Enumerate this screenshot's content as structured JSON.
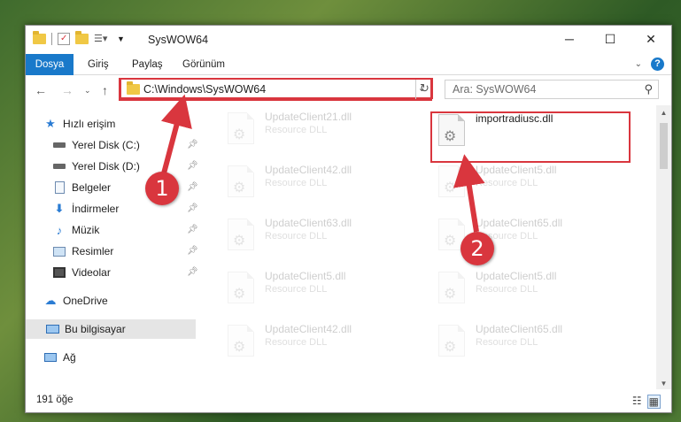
{
  "window": {
    "title": "SysWOW64",
    "controls": [
      "─",
      "☐",
      "✕"
    ]
  },
  "ribbon": {
    "tabs": [
      "Dosya",
      "Giriş",
      "Paylaş",
      "Görünüm"
    ],
    "help": "?"
  },
  "address": {
    "path": "C:\\Windows\\SysWOW64",
    "search_placeholder": "Ara: SysWOW64"
  },
  "nav": {
    "quick_access": "Hızlı erişim",
    "items": [
      {
        "label": "Yerel Disk (C:)",
        "icon": "drive-icon",
        "pinned": true
      },
      {
        "label": "Yerel Disk (D:)",
        "icon": "drive-icon",
        "pinned": true
      },
      {
        "label": "Belgeler",
        "icon": "documents-icon",
        "pinned": true
      },
      {
        "label": "İndirmeler",
        "icon": "downloads-icon",
        "pinned": true
      },
      {
        "label": "Müzik",
        "icon": "music-icon",
        "pinned": true
      },
      {
        "label": "Resimler",
        "icon": "pictures-icon",
        "pinned": true
      },
      {
        "label": "Videolar",
        "icon": "videos-icon",
        "pinned": true
      }
    ],
    "onedrive": "OneDrive",
    "this_pc": "Bu bilgisayar",
    "network": "Ağ"
  },
  "files": [
    {
      "name": "UpdateClient21.dll",
      "desc": "Resource DLL"
    },
    {
      "name": "importradiusc.dll",
      "desc": ""
    },
    {
      "name": "UpdateClient42.dll",
      "desc": "Resource DLL"
    },
    {
      "name": "UpdateClient5.dll",
      "desc": "Resource DLL"
    },
    {
      "name": "UpdateClient63.dll",
      "desc": "Resource DLL"
    },
    {
      "name": "UpdateClient65.dll",
      "desc": "Resource DLL"
    },
    {
      "name": "UpdateClient5.dll",
      "desc": "Resource DLL"
    },
    {
      "name": "UpdateClient5.dll",
      "desc": "Resource DLL"
    },
    {
      "name": "UpdateClient42.dll",
      "desc": "Resource DLL"
    },
    {
      "name": "UpdateClient65.dll",
      "desc": "Resource DLL"
    }
  ],
  "status": {
    "count": "191 öğe"
  },
  "annotations": {
    "step1": "1",
    "step2": "2",
    "color": "#d9363e"
  }
}
